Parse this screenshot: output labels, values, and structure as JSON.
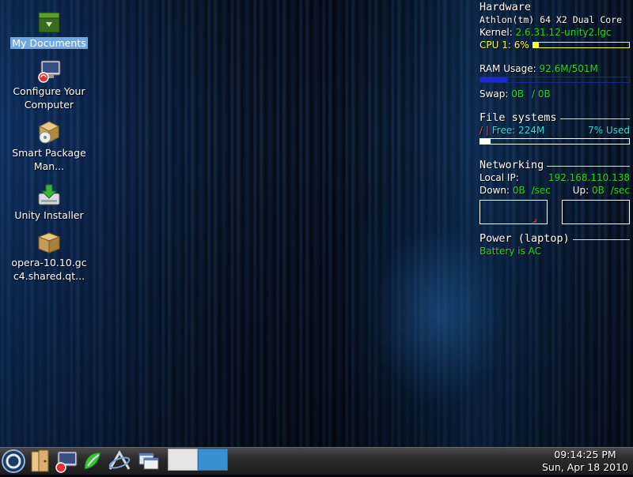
{
  "desktop": {
    "icons": [
      {
        "label": "My Documents",
        "icon": "folder-icon"
      },
      {
        "label": "Configure Your Computer",
        "icon": "monitor-config-icon"
      },
      {
        "label": "Smart Package Man...",
        "icon": "package-manager-icon"
      },
      {
        "label": "Unity Installer",
        "icon": "installer-icon"
      },
      {
        "label": "opera-10.10.gc c4.shared.qt...",
        "icon": "package-box-icon"
      }
    ]
  },
  "conky": {
    "hardware": {
      "title": "Hardware",
      "cpu_model": "Athlon(tm) 64 X2 Dual Core",
      "kernel_label": "Kernel:",
      "kernel_value": "2.6.31.12-unity2.lgc",
      "cpu_label": "CPU 1:",
      "cpu_value": "6%",
      "cpu_percent": 6
    },
    "ram": {
      "label": "RAM Usage:",
      "value": "92.6M/501M",
      "percent": 18,
      "swap_label": "Swap:",
      "swap_used": "0B",
      "swap_total": "/ 0B"
    },
    "filesystems": {
      "title": "File systems",
      "mount": "/",
      "free_label": "Free:",
      "free_value": "224M",
      "used": "7% Used",
      "percent": 7
    },
    "networking": {
      "title": "Networking",
      "ip_label": "Local IP:",
      "ip_value": "192.168.110.138",
      "down_label": "Down:",
      "down_value": "0B",
      "down_unit": "/sec",
      "up_label": "Up:",
      "up_value": "0B",
      "up_unit": "/sec"
    },
    "power": {
      "title": "Power (laptop)",
      "status": "Battery is AC"
    }
  },
  "taskbar": {
    "time": "09:14:25 PM",
    "date": "Sun, Apr 18 2010",
    "launchers": [
      "start-menu-icon",
      "file-manager-icon",
      "configure-computer-icon",
      "package-icon",
      "browser-icon",
      "show-desktop-icon"
    ]
  },
  "colors": {
    "accent_green": "#22dd22",
    "accent_yellow": "#ffff33",
    "accent_cyan": "#33dddd",
    "selection": "#6fa8dc"
  }
}
